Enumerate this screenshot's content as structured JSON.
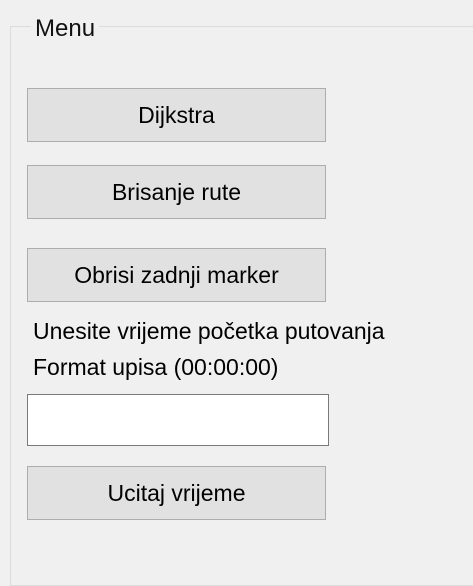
{
  "menu": {
    "title": "Menu",
    "buttons": {
      "dijkstra": "Dijkstra",
      "clear_route": "Brisanje rute",
      "delete_last_marker": "Obrisi zadnji marker",
      "load_time": "Ucitaj vrijeme"
    },
    "time_prompt": "Unesite vrijeme početka putovanja",
    "time_format": "Format upisa (00:00:00)",
    "time_input": {
      "value": "",
      "placeholder": ""
    }
  }
}
